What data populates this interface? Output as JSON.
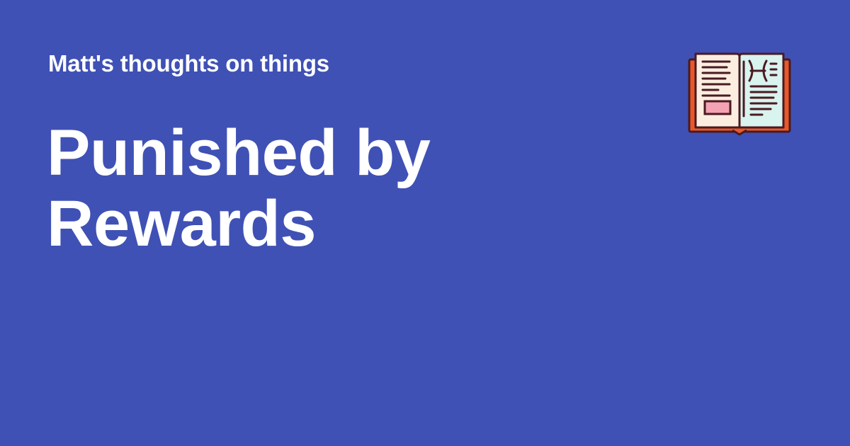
{
  "site": {
    "name": "Matt's thoughts on things"
  },
  "post": {
    "title_lines": [
      "Punished by",
      "Rewards"
    ]
  },
  "icon": {
    "name": "open-book-icon"
  },
  "colors": {
    "background": "#3f51b5",
    "text": "#ffffff",
    "book_cover": "#e8582a",
    "book_outline": "#4a1a22",
    "page_left": "#fbeee0",
    "page_right": "#d9f3ef",
    "label": "#f4a3b4"
  }
}
